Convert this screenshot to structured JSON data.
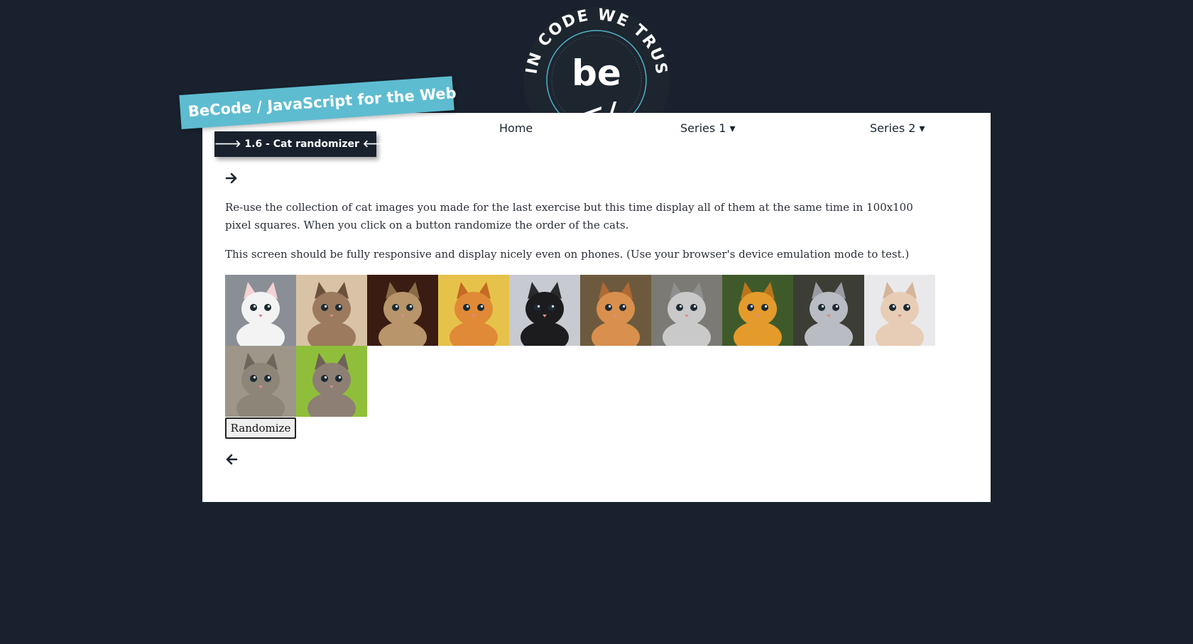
{
  "logo": {
    "arc_text": "IN CODE WE TRUST",
    "be_text": "be",
    "code_text": "</"
  },
  "nav": {
    "home": "Home",
    "series1": "Series 1 ▾",
    "series2": "Series 2 ▾"
  },
  "ribbon": {
    "title": "BeCode / JavaScript for the Web",
    "subtitle": "🡒 1.6 - Cat randomizer 🡐"
  },
  "content": {
    "paragraph1": "Re-use the collection of cat images you made for the last exercise but this time display all of them at the same time in 100x100 pixel squares. When you click on a button randomize the order of the cats.",
    "paragraph2": "This screen should be fully responsive and display nicely even on phones. (Use your browser's device emulation mode to test.)",
    "button_label": "Randomize",
    "next_icon": "arrow-right-icon",
    "prev_icon": "arrow-left-icon"
  },
  "colors": {
    "background": "#18212d",
    "card": "#ffffff",
    "accent": "#5ebcd0"
  },
  "cats": [
    {
      "name": "white-kitten",
      "bg": "#8a8f96",
      "body": "#f3f3f3",
      "ear": "#f2d2d2"
    },
    {
      "name": "fluffy-brown-kitten",
      "bg": "#d9c3a6",
      "body": "#9b7a5e",
      "ear": "#6b513d"
    },
    {
      "name": "tabby-kitten",
      "bg": "#3a1c12",
      "body": "#b8956a",
      "ear": "#8a6b48"
    },
    {
      "name": "orange-kitten",
      "bg": "#e7c24a",
      "body": "#e08a38",
      "ear": "#c46a22"
    },
    {
      "name": "black-white-kitten",
      "bg": "#c7cbd1",
      "body": "#1c1c1e",
      "ear": "#2a2a2c"
    },
    {
      "name": "ginger-kitten",
      "bg": "#6d5a3e",
      "body": "#d9904e",
      "ear": "#b06a33"
    },
    {
      "name": "grey-white-kitten",
      "bg": "#7b7a74",
      "body": "#c9c9c9",
      "ear": "#8f8f8f"
    },
    {
      "name": "puss-in-boots",
      "bg": "#3f5a2a",
      "body": "#e49b2c",
      "ear": "#b8761a"
    },
    {
      "name": "grey-kitten",
      "bg": "#3c3d34",
      "body": "#b9bcc2",
      "ear": "#9a9ca3"
    },
    {
      "name": "cream-kitten",
      "bg": "#e9e9ec",
      "body": "#e8cdb6",
      "ear": "#d5b49a"
    },
    {
      "name": "grey-tabby-lying",
      "bg": "#9d9689",
      "body": "#8e8579",
      "ear": "#6d665c"
    },
    {
      "name": "kitten-in-grass",
      "bg": "#8fbf3a",
      "body": "#8d7f74",
      "ear": "#6f6258"
    }
  ]
}
